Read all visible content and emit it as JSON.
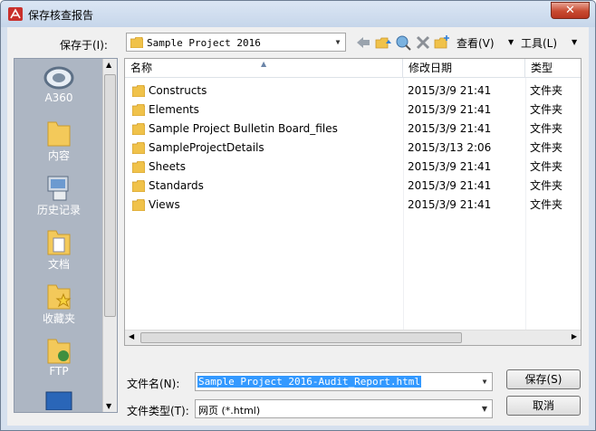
{
  "window": {
    "title": "保存核查报告",
    "close_label": "✕"
  },
  "toolbar": {
    "save_in_label": "保存于(I):",
    "location": "Sample Project 2016",
    "view_label": "查看(V)",
    "tools_label": "工具(L)"
  },
  "places": [
    {
      "label": "A360",
      "icon": "a360-icon"
    },
    {
      "label": "内容",
      "icon": "folder-icon"
    },
    {
      "label": "历史记录",
      "icon": "history-icon"
    },
    {
      "label": "文档",
      "icon": "documents-icon"
    },
    {
      "label": "收藏夹",
      "icon": "favorites-icon"
    },
    {
      "label": "FTP",
      "icon": "ftp-icon"
    }
  ],
  "files": {
    "headers": {
      "name": "名称",
      "date": "修改日期",
      "type": "类型"
    },
    "rows": [
      {
        "name": "Constructs",
        "date": "2015/3/9 21:41",
        "type": "文件夹"
      },
      {
        "name": "Elements",
        "date": "2015/3/9 21:41",
        "type": "文件夹"
      },
      {
        "name": "Sample Project Bulletin Board_files",
        "date": "2015/3/9 21:41",
        "type": "文件夹"
      },
      {
        "name": "SampleProjectDetails",
        "date": "2015/3/13 2:06",
        "type": "文件夹"
      },
      {
        "name": "Sheets",
        "date": "2015/3/9 21:41",
        "type": "文件夹"
      },
      {
        "name": "Standards",
        "date": "2015/3/9 21:41",
        "type": "文件夹"
      },
      {
        "name": "Views",
        "date": "2015/3/9 21:41",
        "type": "文件夹"
      }
    ]
  },
  "footer": {
    "filename_label": "文件名(N):",
    "filename_value": "Sample Project 2016-Audit_Report.html",
    "filetype_label": "文件类型(T):",
    "filetype_value": "网页 (*.html)",
    "save_label": "保存(S)",
    "cancel_label": "取消"
  },
  "colors": {
    "accent": "#3399ff",
    "title_bar": "#c6d6ea",
    "places_bg": "#adb6c3",
    "folder": "#f0c24a"
  }
}
